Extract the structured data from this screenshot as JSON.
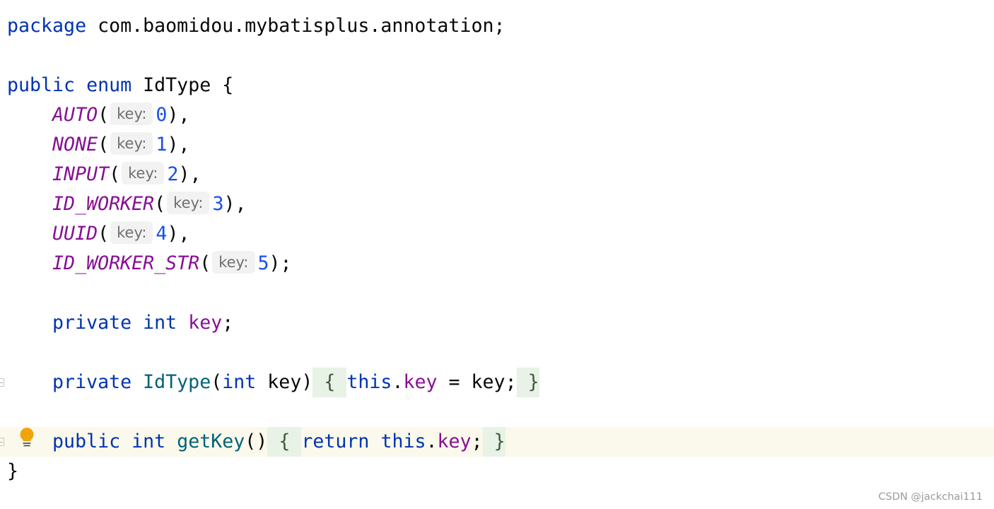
{
  "colors": {
    "keyword": "#0033b3",
    "enum_constant": "#871094",
    "number": "#1750eb",
    "method": "#00627a",
    "current_line": "#fbf9eb",
    "folded_bg": "#e8f2e6",
    "bulb": "#f0a30a"
  },
  "lines": [
    {
      "tokens": [
        {
          "t": "kw",
          "text": "package"
        },
        {
          "t": "plain",
          "text": " com.baomidou.mybatisplus.annotation;"
        }
      ]
    },
    {
      "tokens": []
    },
    {
      "tokens": [
        {
          "t": "kw",
          "text": "public"
        },
        {
          "t": "plain",
          "text": " "
        },
        {
          "t": "kw",
          "text": "enum"
        },
        {
          "t": "plain",
          "text": " IdType {"
        }
      ]
    },
    {
      "tokens": [
        {
          "t": "plain",
          "text": "    "
        },
        {
          "t": "enumc",
          "text": "AUTO"
        },
        {
          "t": "plain",
          "text": "("
        },
        {
          "t": "hint",
          "text": "key:"
        },
        {
          "t": "num",
          "text": "0"
        },
        {
          "t": "plain",
          "text": "),"
        }
      ]
    },
    {
      "tokens": [
        {
          "t": "plain",
          "text": "    "
        },
        {
          "t": "enumc",
          "text": "NONE"
        },
        {
          "t": "plain",
          "text": "("
        },
        {
          "t": "hint",
          "text": "key:"
        },
        {
          "t": "num",
          "text": "1"
        },
        {
          "t": "plain",
          "text": "),"
        }
      ]
    },
    {
      "tokens": [
        {
          "t": "plain",
          "text": "    "
        },
        {
          "t": "enumc",
          "text": "INPUT"
        },
        {
          "t": "plain",
          "text": "("
        },
        {
          "t": "hint",
          "text": "key:"
        },
        {
          "t": "num",
          "text": "2"
        },
        {
          "t": "plain",
          "text": "),"
        }
      ]
    },
    {
      "tokens": [
        {
          "t": "plain",
          "text": "    "
        },
        {
          "t": "enumc",
          "text": "ID_WORKER"
        },
        {
          "t": "plain",
          "text": "("
        },
        {
          "t": "hint",
          "text": "key:"
        },
        {
          "t": "num",
          "text": "3"
        },
        {
          "t": "plain",
          "text": "),"
        }
      ]
    },
    {
      "tokens": [
        {
          "t": "plain",
          "text": "    "
        },
        {
          "t": "enumc",
          "text": "UUID"
        },
        {
          "t": "plain",
          "text": "("
        },
        {
          "t": "hint",
          "text": "key:"
        },
        {
          "t": "num",
          "text": "4"
        },
        {
          "t": "plain",
          "text": "),"
        }
      ]
    },
    {
      "tokens": [
        {
          "t": "plain",
          "text": "    "
        },
        {
          "t": "enumc",
          "text": "ID_WORKER_STR"
        },
        {
          "t": "plain",
          "text": "("
        },
        {
          "t": "hint",
          "text": "key:"
        },
        {
          "t": "num",
          "text": "5"
        },
        {
          "t": "plain",
          "text": ");"
        }
      ]
    },
    {
      "tokens": []
    },
    {
      "tokens": [
        {
          "t": "plain",
          "text": "    "
        },
        {
          "t": "kw",
          "text": "private"
        },
        {
          "t": "plain",
          "text": " "
        },
        {
          "t": "kw",
          "text": "int"
        },
        {
          "t": "plain",
          "text": " "
        },
        {
          "t": "field",
          "text": "key"
        },
        {
          "t": "plain",
          "text": ";"
        }
      ]
    },
    {
      "tokens": []
    },
    {
      "fold": true,
      "tokens": [
        {
          "t": "plain",
          "text": "    "
        },
        {
          "t": "kw",
          "text": "private"
        },
        {
          "t": "plain",
          "text": " "
        },
        {
          "t": "fn",
          "text": "IdType"
        },
        {
          "t": "plain",
          "text": "("
        },
        {
          "t": "kw",
          "text": "int"
        },
        {
          "t": "plain",
          "text": " key)"
        },
        {
          "t": "fold",
          "text": " { "
        },
        {
          "t": "kw",
          "text": "this"
        },
        {
          "t": "plain",
          "text": "."
        },
        {
          "t": "field",
          "text": "key"
        },
        {
          "t": "plain",
          "text": " = key;"
        },
        {
          "t": "fold",
          "text": " }"
        }
      ]
    },
    {
      "tokens": []
    },
    {
      "fold": true,
      "current": true,
      "bulb": true,
      "tokens": [
        {
          "t": "plain",
          "text": "    "
        },
        {
          "t": "kw",
          "text": "public"
        },
        {
          "t": "plain",
          "text": " "
        },
        {
          "t": "kw",
          "text": "int"
        },
        {
          "t": "plain",
          "text": " "
        },
        {
          "t": "fn",
          "text": "getKey"
        },
        {
          "t": "plain",
          "text": "()"
        },
        {
          "t": "fold",
          "text": " { "
        },
        {
          "t": "kw",
          "text": "return"
        },
        {
          "t": "plain",
          "text": " "
        },
        {
          "t": "kw",
          "text": "this"
        },
        {
          "t": "plain",
          "text": "."
        },
        {
          "t": "field",
          "text": "key"
        },
        {
          "t": "plain",
          "text": ";"
        },
        {
          "t": "fold",
          "text": " }"
        }
      ]
    },
    {
      "tokens": [
        {
          "t": "plain",
          "text": "}"
        }
      ]
    }
  ],
  "watermark": "CSDN @jackchai111"
}
